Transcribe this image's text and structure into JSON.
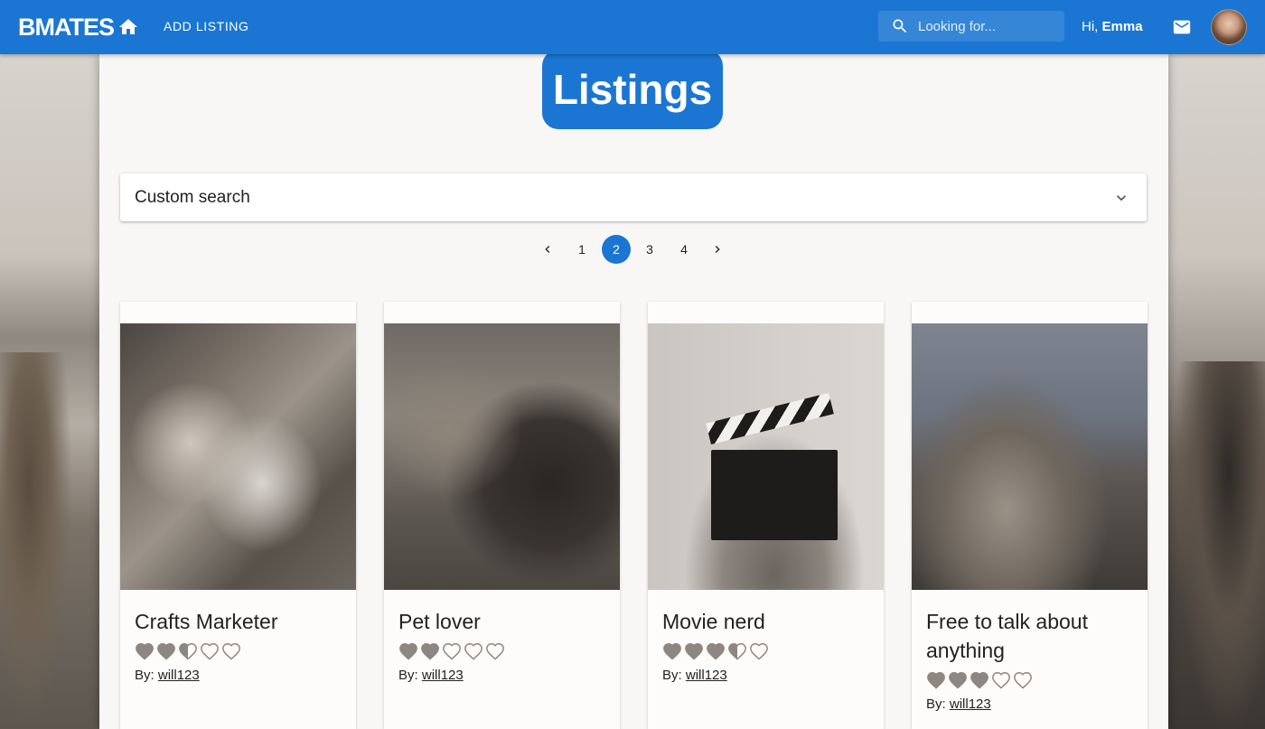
{
  "navbar": {
    "logo": "BMATES",
    "add_listing": "ADD LISTING",
    "search_placeholder": "Looking for...",
    "greeting_prefix": "Hi,",
    "user_name": "Emma",
    "accent_color": "#1a76d2"
  },
  "main": {
    "title": "Listings",
    "custom_search_label": "Custom search",
    "pagination": {
      "pages": [
        "1",
        "2",
        "3",
        "4"
      ],
      "current_page": 2
    }
  },
  "cards": [
    {
      "title": "Crafts Marketer",
      "rating": 2.5,
      "by_label": "By:",
      "author": "will123"
    },
    {
      "title": "Pet lover",
      "rating": 2,
      "by_label": "By:",
      "author": "will123"
    },
    {
      "title": "Movie nerd",
      "rating": 3.5,
      "by_label": "By:",
      "author": "will123"
    },
    {
      "title": "Free to talk about anything",
      "rating": 3,
      "by_label": "By:",
      "author": "will123"
    }
  ],
  "icons": {
    "home": "home-icon",
    "search": "search-icon",
    "mail": "mail-icon",
    "rating": "heart-icon",
    "prev": "chevron-left-icon",
    "next": "chevron-right-icon",
    "expand": "chevron-down-icon"
  }
}
